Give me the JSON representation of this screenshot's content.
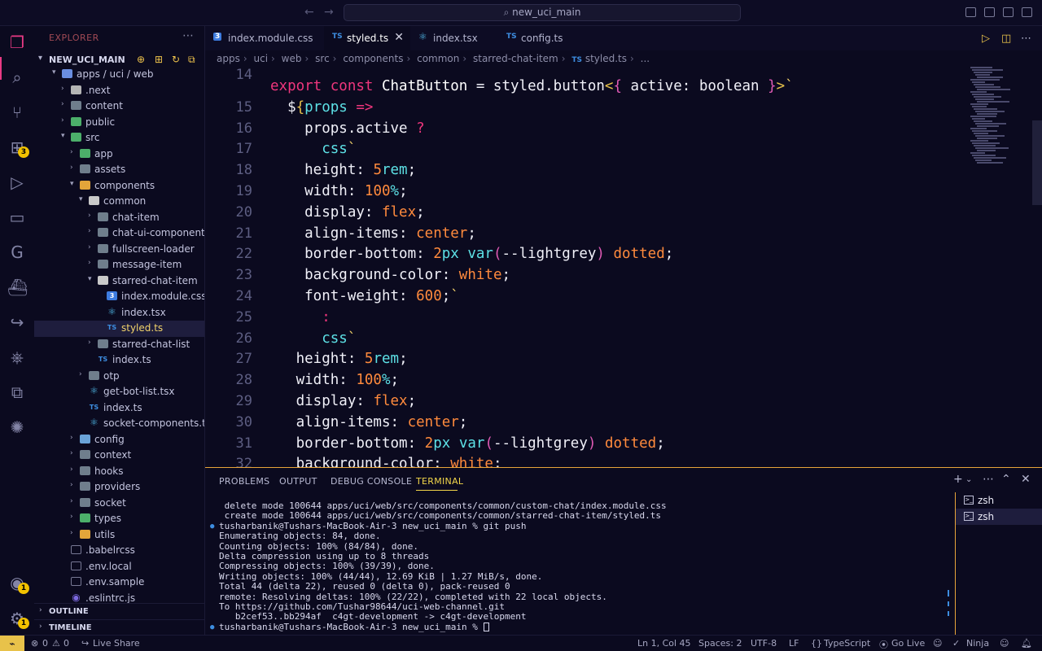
{
  "titlebar": {
    "search": "new_uci_main",
    "back": "←",
    "forward": "→"
  },
  "activity": {
    "extensions_badge": "3",
    "accounts_badge": "1",
    "settings_badge": "1"
  },
  "sidebar": {
    "title": "EXPLORER",
    "root": "NEW_UCI_MAIN",
    "tree": [
      {
        "label": "apps / uci / web",
        "depth": 0,
        "type": "folder-open-blue",
        "chev": "v"
      },
      {
        "label": ".next",
        "depth": 1,
        "type": "folder-special",
        "chev": ">"
      },
      {
        "label": "content",
        "depth": 1,
        "type": "folder",
        "chev": ">"
      },
      {
        "label": "public",
        "depth": 1,
        "type": "folder-green",
        "chev": ">"
      },
      {
        "label": "src",
        "depth": 1,
        "type": "folder-green",
        "chev": "v"
      },
      {
        "label": "app",
        "depth": 2,
        "type": "folder-green",
        "chev": ">"
      },
      {
        "label": "assets",
        "depth": 2,
        "type": "folder",
        "chev": ">"
      },
      {
        "label": "components",
        "depth": 2,
        "type": "folder-orange",
        "chev": "v"
      },
      {
        "label": "common",
        "depth": 3,
        "type": "folder-open",
        "chev": "v"
      },
      {
        "label": "chat-item",
        "depth": 4,
        "type": "folder",
        "chev": ">"
      },
      {
        "label": "chat-ui-component",
        "depth": 4,
        "type": "folder",
        "chev": ">"
      },
      {
        "label": "fullscreen-loader",
        "depth": 4,
        "type": "folder",
        "chev": ">"
      },
      {
        "label": "message-item",
        "depth": 4,
        "type": "folder",
        "chev": ">"
      },
      {
        "label": "starred-chat-item",
        "depth": 4,
        "type": "folder-open",
        "chev": "v"
      },
      {
        "label": "index.module.css",
        "depth": 5,
        "type": "css",
        "chev": ""
      },
      {
        "label": "index.tsx",
        "depth": 5,
        "type": "react",
        "chev": ""
      },
      {
        "label": "styled.ts",
        "depth": 5,
        "type": "ts",
        "chev": "",
        "selected": true
      },
      {
        "label": "starred-chat-list",
        "depth": 4,
        "type": "folder",
        "chev": ">"
      },
      {
        "label": "index.ts",
        "depth": 4,
        "type": "ts",
        "chev": ""
      },
      {
        "label": "otp",
        "depth": 3,
        "type": "folder",
        "chev": ">"
      },
      {
        "label": "get-bot-list.tsx",
        "depth": 3,
        "type": "react",
        "chev": ""
      },
      {
        "label": "index.ts",
        "depth": 3,
        "type": "ts",
        "chev": ""
      },
      {
        "label": "socket-components.tsx",
        "depth": 3,
        "type": "react",
        "chev": ""
      },
      {
        "label": "config",
        "depth": 2,
        "type": "folder-blue",
        "chev": ">"
      },
      {
        "label": "context",
        "depth": 2,
        "type": "folder",
        "chev": ">"
      },
      {
        "label": "hooks",
        "depth": 2,
        "type": "folder",
        "chev": ">"
      },
      {
        "label": "providers",
        "depth": 2,
        "type": "folder",
        "chev": ">"
      },
      {
        "label": "socket",
        "depth": 2,
        "type": "folder",
        "chev": ">"
      },
      {
        "label": "types",
        "depth": 2,
        "type": "folder-green",
        "chev": ">"
      },
      {
        "label": "utils",
        "depth": 2,
        "type": "folder-orange",
        "chev": ">"
      },
      {
        "label": ".babelrcss",
        "depth": 1,
        "type": "file",
        "chev": ""
      },
      {
        "label": ".env.local",
        "depth": 1,
        "type": "file",
        "chev": ""
      },
      {
        "label": ".env.sample",
        "depth": 1,
        "type": "file",
        "chev": ""
      },
      {
        "label": ".eslintrc.js",
        "depth": 1,
        "type": "eslint",
        "chev": ""
      }
    ],
    "outline": "OUTLINE",
    "timeline": "TIMELINE"
  },
  "tabs": [
    {
      "label": "index.module.css",
      "icon": "css",
      "active": false
    },
    {
      "label": "styled.ts",
      "icon": "TS",
      "active": true,
      "close": "✕"
    },
    {
      "label": "index.tsx",
      "icon": "react",
      "active": false
    },
    {
      "label": "config.ts",
      "icon": "TS",
      "active": false
    }
  ],
  "breadcrumb": [
    "apps",
    "uci",
    "web",
    "src",
    "components",
    "common",
    "starred-chat-item",
    "TS",
    "styled.ts",
    "..."
  ],
  "editor": {
    "line_numbers": [
      "14",
      "15",
      "16",
      "17",
      "18",
      "19",
      "20",
      "21",
      "22",
      "23",
      "24",
      "25",
      "26",
      "27",
      "28",
      "29",
      "30",
      "31",
      "32"
    ]
  },
  "panel": {
    "tabs": [
      "PROBLEMS",
      "OUTPUT",
      "DEBUG CONSOLE",
      "TERMINAL"
    ],
    "active_tab": "TERMINAL",
    "terminal_lines": [
      " delete mode 100644 apps/uci/web/src/components/common/custom-chat/index.module.css",
      " create mode 100644 apps/uci/web/src/components/common/starred-chat-item/styled.ts",
      "tusharbanik@Tushars-MacBook-Air-3 new_uci_main % git push",
      "Enumerating objects: 84, done.",
      "Counting objects: 100% (84/84), done.",
      "Delta compression using up to 8 threads",
      "Compressing objects: 100% (39/39), done.",
      "Writing objects: 100% (44/44), 12.69 KiB | 1.27 MiB/s, done.",
      "Total 44 (delta 22), reused 0 (delta 0), pack-reused 0",
      "remote: Resolving deltas: 100% (22/22), completed with 22 local objects.",
      "To https://github.com/Tushar98644/uci-web-channel.git",
      "   b2cef53..bb294af  c4gt-development -> c4gt-development",
      "tusharbanik@Tushars-MacBook-Air-3 new_uci_main % "
    ],
    "terminals": [
      "zsh",
      "zsh"
    ]
  },
  "statusbar": {
    "remote": "⌁",
    "errors": "0",
    "warnings": "0",
    "live_share": "Live Share",
    "position": "Ln 1, Col 45",
    "spaces": "Spaces: 2",
    "encoding": "UTF-8",
    "eol": "LF",
    "language": "TypeScript",
    "go_live": "Go Live",
    "ninja": "Ninja"
  }
}
